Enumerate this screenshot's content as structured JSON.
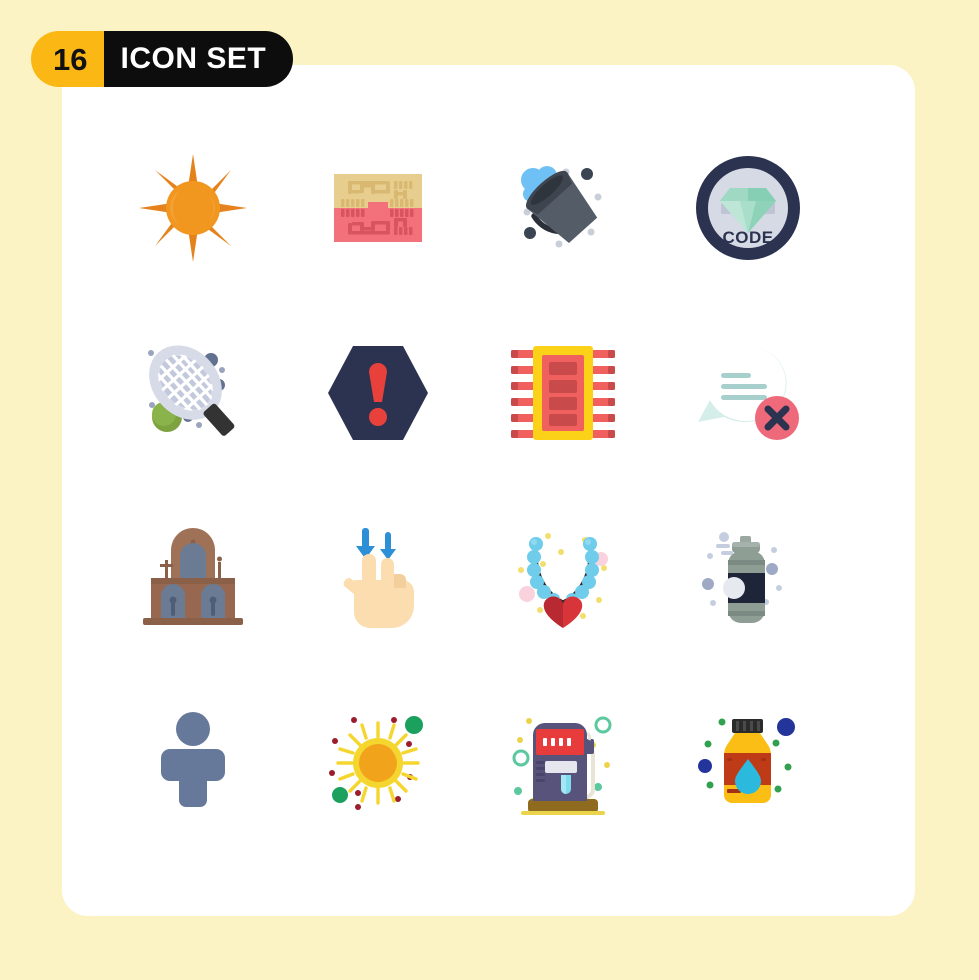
{
  "page": {
    "background_color": "#FCF3C4",
    "card_color": "#FFFFFF",
    "title": "ICON SET"
  },
  "header": {
    "count": "16",
    "label": "ICON SET",
    "count_bg": "#FBB713",
    "count_fg": "#121212",
    "label_bg": "#0D0D0D",
    "label_fg": "#FFFFFF"
  },
  "grid": {
    "columns": 4,
    "rows": 4,
    "total": 16
  },
  "icons": [
    {
      "index": 1,
      "row": 1,
      "col": 1,
      "name": "sun-icon",
      "label": "Sun",
      "colors": [
        "#F1961F",
        "#E5821B"
      ]
    },
    {
      "index": 2,
      "row": 1,
      "col": 2,
      "name": "ram-memory-icon",
      "label": "Ram Memory",
      "colors": [
        "#E8CE8E",
        "#F2717A"
      ]
    },
    {
      "index": 3,
      "row": 1,
      "col": 3,
      "name": "bucket-icon",
      "label": "Bucket",
      "colors": [
        "#414A56",
        "#5C6470",
        "#5BB4F0"
      ]
    },
    {
      "index": 4,
      "row": 1,
      "col": 4,
      "name": "code-badge-icon",
      "label": "Code",
      "colors": [
        "#2C3350",
        "#D6DAE5",
        "#8FD6BD"
      ]
    },
    {
      "index": 5,
      "row": 2,
      "col": 1,
      "name": "tennis-racket-icon",
      "label": "Tennis Racket",
      "colors": [
        "#D5D9E6",
        "#333333",
        "#7AA744"
      ]
    },
    {
      "index": 6,
      "row": 2,
      "col": 2,
      "name": "warning-icon",
      "label": "Warning",
      "colors": [
        "#2C3350",
        "#E8413C"
      ]
    },
    {
      "index": 7,
      "row": 2,
      "col": 3,
      "name": "microchip-icon",
      "label": "Microchip",
      "colors": [
        "#FBD217",
        "#F0605E",
        "#C94A4B"
      ]
    },
    {
      "index": 8,
      "row": 2,
      "col": 4,
      "name": "delete-message-icon",
      "label": "Delete Message",
      "colors": [
        "#D6EEEA",
        "#EE6A7A",
        "#2C3350"
      ]
    },
    {
      "index": 9,
      "row": 3,
      "col": 1,
      "name": "church-icon",
      "label": "Church",
      "colors": [
        "#97674F",
        "#6A7B93"
      ]
    },
    {
      "index": 10,
      "row": 3,
      "col": 2,
      "name": "two-finger-swipe-down-icon",
      "label": "Swipe Down",
      "colors": [
        "#FBDDB0",
        "#2D8FD5"
      ]
    },
    {
      "index": 11,
      "row": 3,
      "col": 3,
      "name": "necklace-icon",
      "label": "Necklace",
      "colors": [
        "#6FCCEA",
        "#D8353A",
        "#F3DE6E"
      ]
    },
    {
      "index": 12,
      "row": 3,
      "col": 4,
      "name": "spray-can-icon",
      "label": "Spray Can",
      "colors": [
        "#8E9E95",
        "#1E2538",
        "#B9C5D9"
      ]
    },
    {
      "index": 13,
      "row": 4,
      "col": 1,
      "name": "person-icon",
      "label": "Person",
      "colors": [
        "#66799A"
      ]
    },
    {
      "index": 14,
      "row": 4,
      "col": 2,
      "name": "sunny-icon",
      "label": "Sunny",
      "colors": [
        "#F5D62E",
        "#F2A31C",
        "#1CA05E",
        "#9C1D2E"
      ]
    },
    {
      "index": 15,
      "row": 4,
      "col": 3,
      "name": "fuel-pump-icon",
      "label": "Fuel Pump",
      "colors": [
        "#58537A",
        "#E83C3C",
        "#8E6B1F"
      ]
    },
    {
      "index": 16,
      "row": 4,
      "col": 4,
      "name": "medicine-bottle-icon",
      "label": "Medicine Bottle",
      "colors": [
        "#FBBE15",
        "#BF3A17",
        "#2CB9DE",
        "#23349A"
      ]
    }
  ]
}
